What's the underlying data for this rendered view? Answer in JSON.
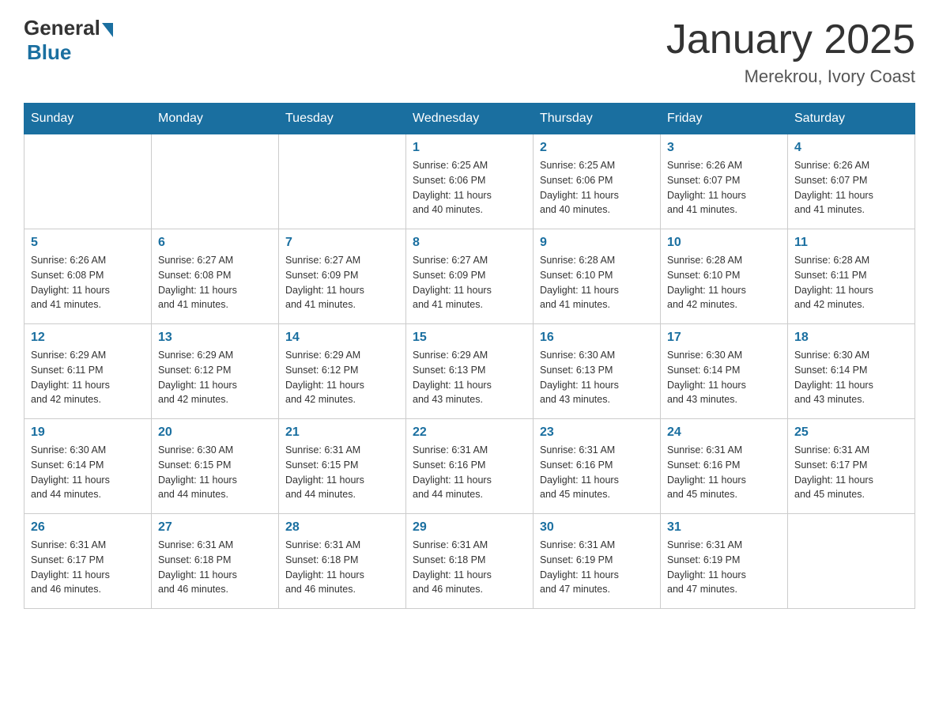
{
  "header": {
    "logo": {
      "general": "General",
      "blue": "Blue"
    },
    "title": "January 2025",
    "subtitle": "Merekrou, Ivory Coast"
  },
  "days_of_week": [
    "Sunday",
    "Monday",
    "Tuesday",
    "Wednesday",
    "Thursday",
    "Friday",
    "Saturday"
  ],
  "weeks": [
    [
      {
        "day": "",
        "info": ""
      },
      {
        "day": "",
        "info": ""
      },
      {
        "day": "",
        "info": ""
      },
      {
        "day": "1",
        "info": "Sunrise: 6:25 AM\nSunset: 6:06 PM\nDaylight: 11 hours\nand 40 minutes."
      },
      {
        "day": "2",
        "info": "Sunrise: 6:25 AM\nSunset: 6:06 PM\nDaylight: 11 hours\nand 40 minutes."
      },
      {
        "day": "3",
        "info": "Sunrise: 6:26 AM\nSunset: 6:07 PM\nDaylight: 11 hours\nand 41 minutes."
      },
      {
        "day": "4",
        "info": "Sunrise: 6:26 AM\nSunset: 6:07 PM\nDaylight: 11 hours\nand 41 minutes."
      }
    ],
    [
      {
        "day": "5",
        "info": "Sunrise: 6:26 AM\nSunset: 6:08 PM\nDaylight: 11 hours\nand 41 minutes."
      },
      {
        "day": "6",
        "info": "Sunrise: 6:27 AM\nSunset: 6:08 PM\nDaylight: 11 hours\nand 41 minutes."
      },
      {
        "day": "7",
        "info": "Sunrise: 6:27 AM\nSunset: 6:09 PM\nDaylight: 11 hours\nand 41 minutes."
      },
      {
        "day": "8",
        "info": "Sunrise: 6:27 AM\nSunset: 6:09 PM\nDaylight: 11 hours\nand 41 minutes."
      },
      {
        "day": "9",
        "info": "Sunrise: 6:28 AM\nSunset: 6:10 PM\nDaylight: 11 hours\nand 41 minutes."
      },
      {
        "day": "10",
        "info": "Sunrise: 6:28 AM\nSunset: 6:10 PM\nDaylight: 11 hours\nand 42 minutes."
      },
      {
        "day": "11",
        "info": "Sunrise: 6:28 AM\nSunset: 6:11 PM\nDaylight: 11 hours\nand 42 minutes."
      }
    ],
    [
      {
        "day": "12",
        "info": "Sunrise: 6:29 AM\nSunset: 6:11 PM\nDaylight: 11 hours\nand 42 minutes."
      },
      {
        "day": "13",
        "info": "Sunrise: 6:29 AM\nSunset: 6:12 PM\nDaylight: 11 hours\nand 42 minutes."
      },
      {
        "day": "14",
        "info": "Sunrise: 6:29 AM\nSunset: 6:12 PM\nDaylight: 11 hours\nand 42 minutes."
      },
      {
        "day": "15",
        "info": "Sunrise: 6:29 AM\nSunset: 6:13 PM\nDaylight: 11 hours\nand 43 minutes."
      },
      {
        "day": "16",
        "info": "Sunrise: 6:30 AM\nSunset: 6:13 PM\nDaylight: 11 hours\nand 43 minutes."
      },
      {
        "day": "17",
        "info": "Sunrise: 6:30 AM\nSunset: 6:14 PM\nDaylight: 11 hours\nand 43 minutes."
      },
      {
        "day": "18",
        "info": "Sunrise: 6:30 AM\nSunset: 6:14 PM\nDaylight: 11 hours\nand 43 minutes."
      }
    ],
    [
      {
        "day": "19",
        "info": "Sunrise: 6:30 AM\nSunset: 6:14 PM\nDaylight: 11 hours\nand 44 minutes."
      },
      {
        "day": "20",
        "info": "Sunrise: 6:30 AM\nSunset: 6:15 PM\nDaylight: 11 hours\nand 44 minutes."
      },
      {
        "day": "21",
        "info": "Sunrise: 6:31 AM\nSunset: 6:15 PM\nDaylight: 11 hours\nand 44 minutes."
      },
      {
        "day": "22",
        "info": "Sunrise: 6:31 AM\nSunset: 6:16 PM\nDaylight: 11 hours\nand 44 minutes."
      },
      {
        "day": "23",
        "info": "Sunrise: 6:31 AM\nSunset: 6:16 PM\nDaylight: 11 hours\nand 45 minutes."
      },
      {
        "day": "24",
        "info": "Sunrise: 6:31 AM\nSunset: 6:16 PM\nDaylight: 11 hours\nand 45 minutes."
      },
      {
        "day": "25",
        "info": "Sunrise: 6:31 AM\nSunset: 6:17 PM\nDaylight: 11 hours\nand 45 minutes."
      }
    ],
    [
      {
        "day": "26",
        "info": "Sunrise: 6:31 AM\nSunset: 6:17 PM\nDaylight: 11 hours\nand 46 minutes."
      },
      {
        "day": "27",
        "info": "Sunrise: 6:31 AM\nSunset: 6:18 PM\nDaylight: 11 hours\nand 46 minutes."
      },
      {
        "day": "28",
        "info": "Sunrise: 6:31 AM\nSunset: 6:18 PM\nDaylight: 11 hours\nand 46 minutes."
      },
      {
        "day": "29",
        "info": "Sunrise: 6:31 AM\nSunset: 6:18 PM\nDaylight: 11 hours\nand 46 minutes."
      },
      {
        "day": "30",
        "info": "Sunrise: 6:31 AM\nSunset: 6:19 PM\nDaylight: 11 hours\nand 47 minutes."
      },
      {
        "day": "31",
        "info": "Sunrise: 6:31 AM\nSunset: 6:19 PM\nDaylight: 11 hours\nand 47 minutes."
      },
      {
        "day": "",
        "info": ""
      }
    ]
  ]
}
